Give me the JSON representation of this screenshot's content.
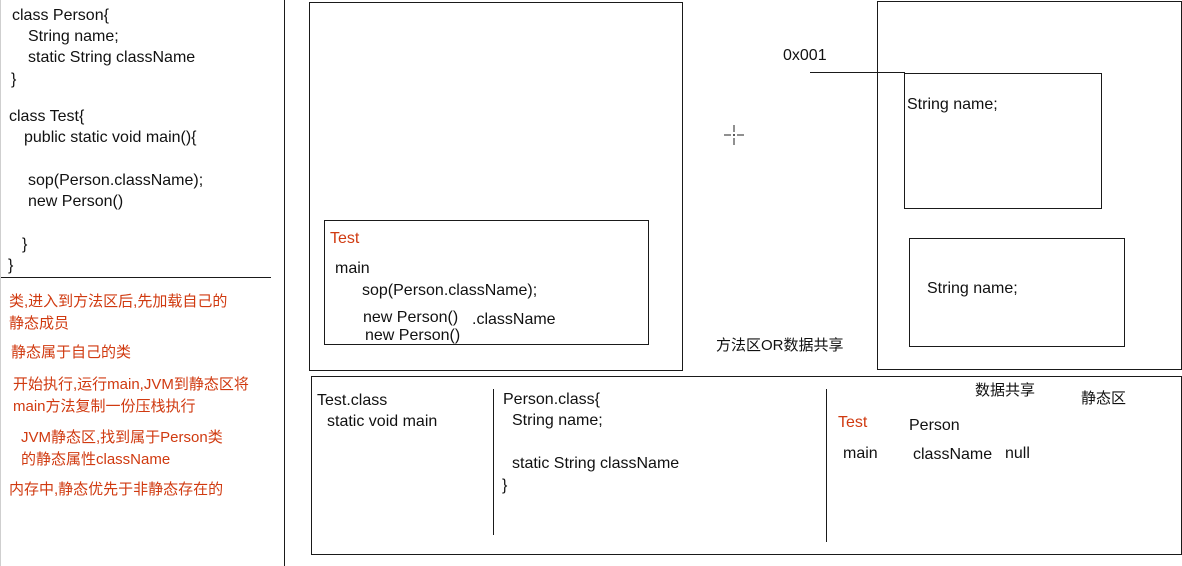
{
  "code": {
    "lines": [
      "class Person{",
      "String name;",
      "static String className",
      "}",
      "class Test{",
      "public static void main(){",
      "sop(Person.className);",
      "new Person()",
      "}",
      "}"
    ]
  },
  "notes": {
    "n1_line1": "类,进入到方法区后,先加载自己的",
    "n1_line2": "静态成员",
    "n2": "静态属于自己的类",
    "n3_line1": "开始执行,运行main,JVM到静态区将",
    "n3_line2": "main方法复制一份压栈执行",
    "n4_line1": "JVM静态区,找到属于Person类",
    "n4_line2": "的静态属性className",
    "n5": "内存中,静态优先于非静态存在的"
  },
  "stack": {
    "frame_title": "Test",
    "main": "main",
    "sop": "sop(Person.className);",
    "new1": "new Person()",
    "classname_ref": ".className",
    "new2": "new Person()"
  },
  "heap": {
    "address": "0x001",
    "obj1_field": "String name;",
    "obj2_field": "String name;"
  },
  "labels": {
    "method_area": "方法区OR数据共享",
    "data_shared": "数据共享",
    "static_area": "静态区"
  },
  "method_area": {
    "test_class": "Test.class",
    "test_main": "static void main",
    "person_class": "Person.class{",
    "person_name": "String name;",
    "person_static": "static String className",
    "person_close": "}"
  },
  "static_area": {
    "test_label": "Test",
    "test_main": "main",
    "person_label": "Person",
    "classname": "className",
    "null_value": "null"
  },
  "colors": {
    "accent_red": "#d03a10",
    "line": "#1a1a1a"
  }
}
